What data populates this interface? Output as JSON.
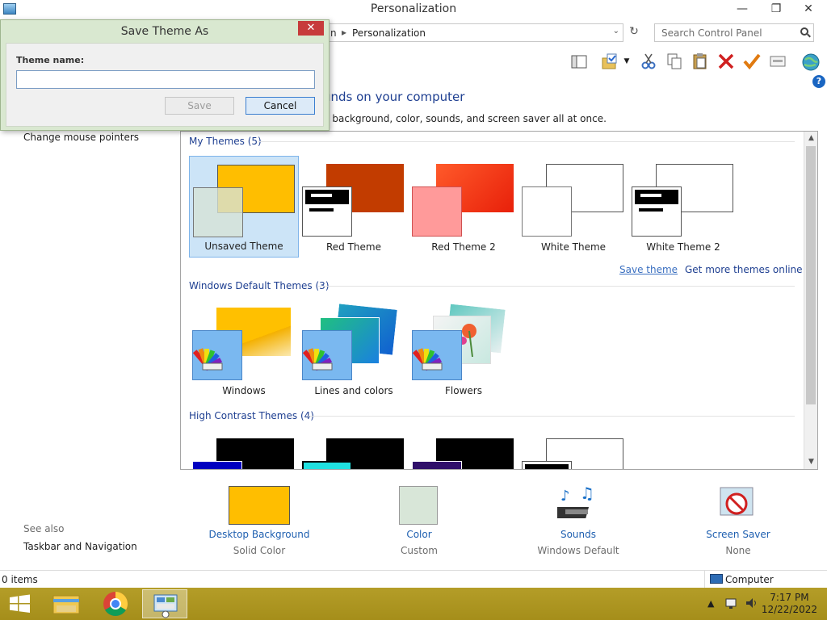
{
  "window": {
    "title": "Personalization",
    "minimize_glyph": "—",
    "restore_glyph": "❐",
    "close_glyph": "✕"
  },
  "address": {
    "crumb_partial": "n",
    "separator": "▸",
    "current": "Personalization",
    "dropdown_glyph": "⌄",
    "refresh_glyph": "↻"
  },
  "search": {
    "placeholder": "Search Control Panel"
  },
  "toolbar": {
    "icons": [
      "layout-icon",
      "folder-check-icon",
      "dropdown-icon",
      "cut-icon",
      "copy-icon",
      "paste-icon",
      "delete-icon",
      "checkmark-icon",
      "properties-icon",
      "globe-icon"
    ]
  },
  "help": {
    "glyph": "?"
  },
  "main": {
    "heading_partial": "unds on your computer",
    "subheading_partial": "p background, color, sounds, and screen saver all at once."
  },
  "left": {
    "links": [
      "Change mouse pointers"
    ],
    "see_also_label": "See also",
    "see_also_links": [
      "Taskbar and Navigation"
    ]
  },
  "themes": {
    "my_themes_label": "My Themes (5)",
    "my_themes": [
      {
        "name": "Unsaved Theme",
        "selected": true
      },
      {
        "name": "Red Theme",
        "selected": false
      },
      {
        "name": "Red Theme 2",
        "selected": false
      },
      {
        "name": "White Theme",
        "selected": false
      },
      {
        "name": "White Theme 2",
        "selected": false
      }
    ],
    "save_theme_link": "Save theme",
    "get_more_link": "Get more themes online",
    "default_label": "Windows Default Themes (3)",
    "default_themes": [
      {
        "name": "Windows"
      },
      {
        "name": "Lines and colors"
      },
      {
        "name": "Flowers"
      }
    ],
    "high_contrast_label": "High Contrast Themes (4)"
  },
  "settings": [
    {
      "name": "Desktop Background",
      "value": "Solid Color"
    },
    {
      "name": "Color",
      "value": "Custom"
    },
    {
      "name": "Sounds",
      "value": "Windows Default"
    },
    {
      "name": "Screen Saver",
      "value": "None"
    }
  ],
  "status": {
    "items": "0 items",
    "location": "Computer"
  },
  "taskbar": {
    "time": "7:17 PM",
    "date": "12/22/2022",
    "tray_up_glyph": "▲"
  },
  "dialog": {
    "title": "Save Theme As",
    "close_glyph": "✕",
    "field_label": "Theme name:",
    "field_value": "",
    "save_label": "Save",
    "cancel_label": "Cancel"
  },
  "colors": {
    "accent_blue": "#1e3f91",
    "taskbar": "#a6931f",
    "dialog_frame": "#d9e8d0",
    "desktop_background": "#ffbe00"
  }
}
